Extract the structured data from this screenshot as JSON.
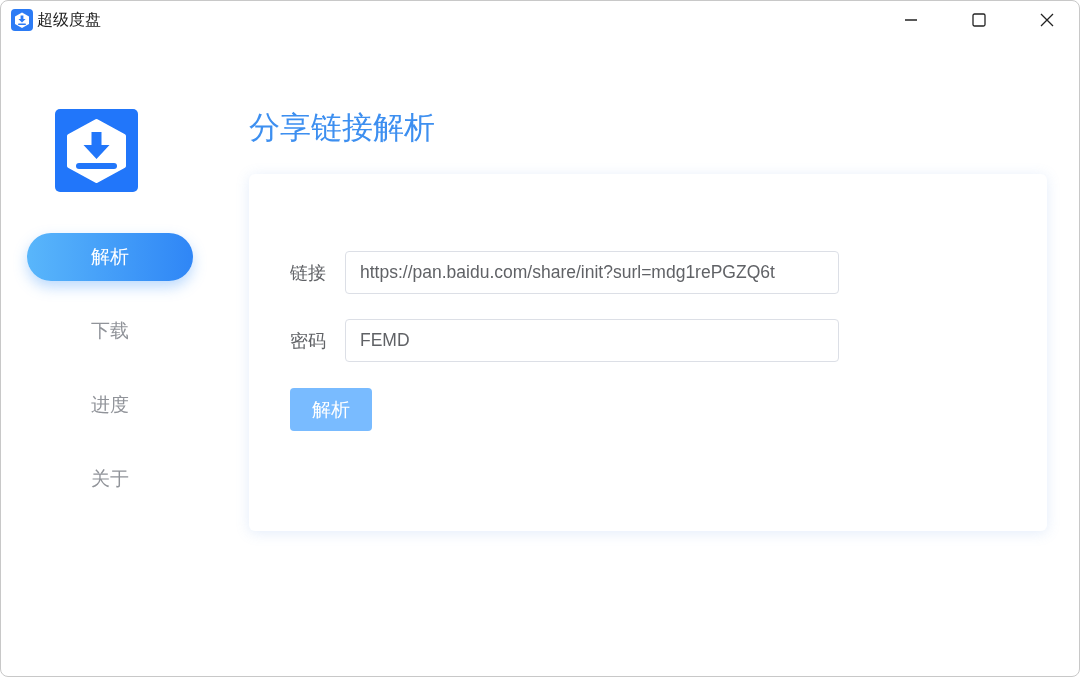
{
  "window": {
    "title": "超级度盘"
  },
  "sidebar": {
    "items": [
      {
        "label": "解析",
        "selected": true
      },
      {
        "label": "下载",
        "selected": false
      },
      {
        "label": "进度",
        "selected": false
      },
      {
        "label": "关于",
        "selected": false
      }
    ]
  },
  "page": {
    "title": "分享链接解析",
    "fields": [
      {
        "label": "链接",
        "value": "https://pan.baidu.com/share/init?surl=mdg1rePGZQ6t"
      },
      {
        "label": "密码",
        "value": "FEMD"
      }
    ],
    "button": {
      "label": "解析",
      "disabled": true
    }
  }
}
